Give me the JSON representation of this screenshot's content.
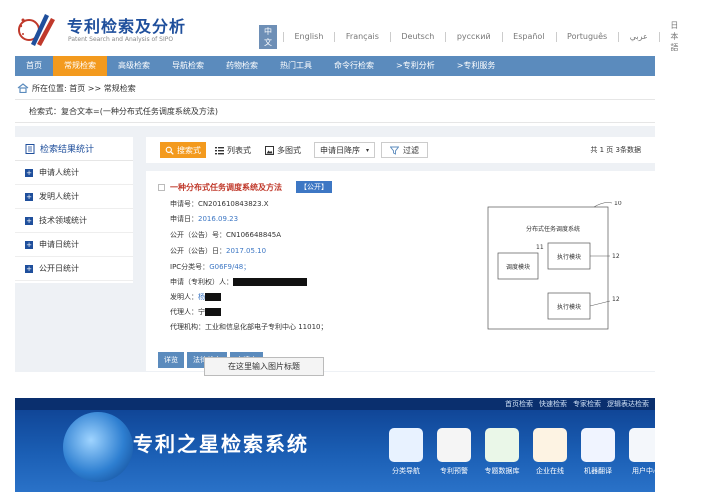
{
  "header": {
    "title": "专利检索及分析",
    "subtitle": "Patent Search and Analysis of SIPO",
    "languages": [
      {
        "label": "中文",
        "active": true
      },
      {
        "label": "English"
      },
      {
        "label": "Français"
      },
      {
        "label": "Deutsch"
      },
      {
        "label": "русский"
      },
      {
        "label": "Español"
      },
      {
        "label": "Português"
      },
      {
        "label": "عربي"
      },
      {
        "label": "日本語"
      }
    ]
  },
  "nav": {
    "items": [
      "首页",
      "常规检索",
      "高级检索",
      "导航检索",
      "药物检索",
      "热门工具",
      "命令行检索",
      ">专利分析",
      ">专利服务"
    ],
    "active_index": 1
  },
  "breadcrumb": "所在位置: 首页 >> 常规检索",
  "query": "检索式：复合文本=(一种分布式任务调度系统及方法)",
  "sidebar": {
    "title": "检索结果统计",
    "items": [
      "申请人统计",
      "发明人统计",
      "技术领域统计",
      "申请日统计",
      "公开日统计"
    ]
  },
  "toolbar": {
    "view_search": "搜索式",
    "view_list": "列表式",
    "view_multi": "多图式",
    "sort": "申请日降序",
    "filter": "过滤",
    "pages": "共 1 页 3条数据"
  },
  "result": {
    "title": "一种分布式任务调度系统及方法",
    "badge": "【公开】",
    "app_no_label": "申请号：",
    "app_no": "CN201610843823.X",
    "app_date_label": "申请日：",
    "app_date": "2016.09.23",
    "pub_no_label": "公开（公告）号：",
    "pub_no": "CN106648845A",
    "pub_date_label": "公开（公告）日：",
    "pub_date": "2017.05.10",
    "ipc_label": "IPC分类号：",
    "ipc": "G06F9/48；",
    "applicant_label": "申请（专利权）人：",
    "applicant_prefix": "",
    "inventor_label": "发明人：",
    "inventor_prefix": "杨",
    "agent_label": "代理人：",
    "agent_prefix": "宁",
    "agency": "代理机构：工业和信息化部电子专利中心 11010；",
    "actions": [
      "详览",
      "法律状态",
      "申请人"
    ]
  },
  "diagram": {
    "system_label": "分布式任务调度系统",
    "scheduler_label": "调度模块",
    "executor_label": "执行模块",
    "ref_system": "10",
    "ref_scheduler": "11",
    "ref_executor": "12"
  },
  "tooltip": "在这里输入图片标题",
  "banner": {
    "title": "专利之星检索系统",
    "links": [
      "首页检索",
      "快速检索",
      "专家检索",
      "逻辑表达检索"
    ],
    "tiles": [
      {
        "label": "分类导航",
        "color": "#e8f2ff"
      },
      {
        "label": "专利预警",
        "color": "#f5f5f5"
      },
      {
        "label": "专题数据库",
        "color": "#eaf7e8"
      },
      {
        "label": "企业在线",
        "color": "#fdf3e3"
      },
      {
        "label": "机器翻译",
        "color": "#f0f4ff"
      },
      {
        "label": "用户中心",
        "color": "#f4f7fb"
      }
    ]
  },
  "colors": {
    "brand_blue": "#1f4f9c",
    "nav_blue": "#5b8bbd",
    "accent_orange": "#f39a1e",
    "title_red": "#c0392b"
  }
}
